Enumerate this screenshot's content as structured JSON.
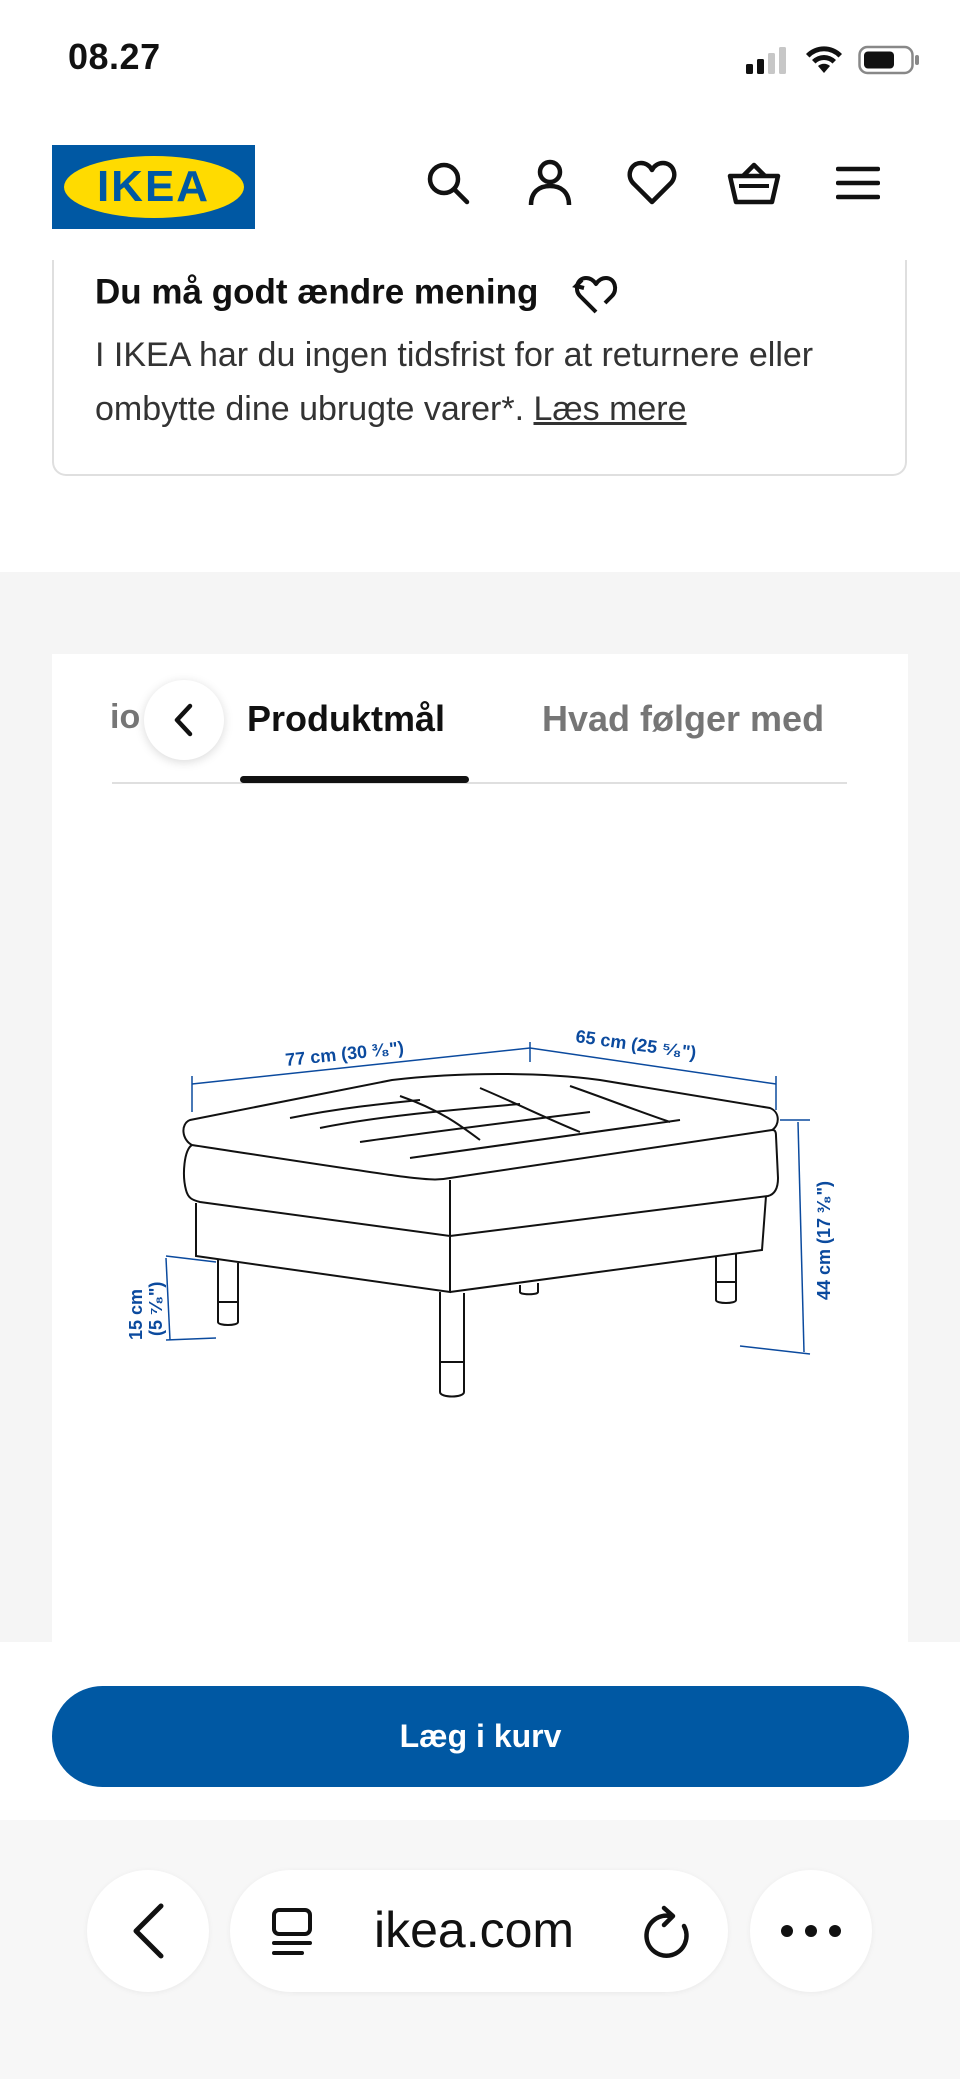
{
  "status_bar": {
    "time": "08.27"
  },
  "header": {
    "logo_text": "IKEA",
    "icons": [
      "search-icon",
      "profile-icon",
      "heart-icon",
      "basket-icon",
      "menu-icon"
    ]
  },
  "return_card": {
    "title": "Du må godt ændre mening",
    "body": "I IKEA har du ingen tidsfrist for at returnere eller ombytte dine ubrugte varer*.",
    "link": "Læs mere"
  },
  "tabs": {
    "partial_label": "io",
    "active_label": "Produktmål",
    "next_label": "Hvad følger med"
  },
  "diagram": {
    "width_label": "77 cm (30 ³⁄₈\")",
    "depth_label": "65 cm (25 ⁵⁄₈\")",
    "height_label": "44 cm (17 ³⁄₈\")",
    "leg_label_cm": "15 cm",
    "leg_label_in": "(5 ⁷⁄₈\")"
  },
  "actions": {
    "add_to_cart": "Læg i kurv"
  },
  "browser": {
    "url": "ikea.com"
  },
  "colors": {
    "brand_blue": "#0058a3",
    "brand_yellow": "#ffdb00",
    "dimension_blue": "#0b4a9e"
  }
}
